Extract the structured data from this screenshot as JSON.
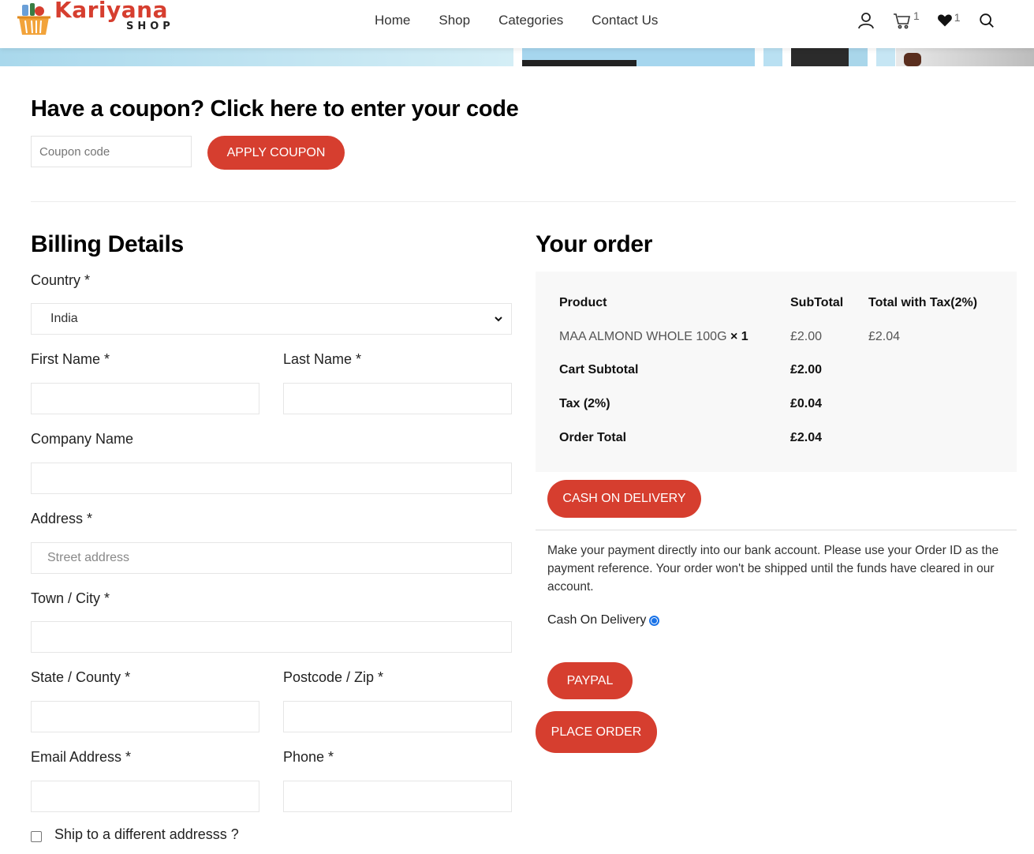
{
  "brand": {
    "name": "Kariyana",
    "sub": "SHOP"
  },
  "nav": [
    "Home",
    "Shop",
    "Categories",
    "Contact Us"
  ],
  "header_icons": {
    "cart_count": "1",
    "wishlist_count": "1"
  },
  "coupon": {
    "title": "Have a coupon? Click here to enter your code",
    "placeholder": "Coupon code",
    "button": "APPLY COUPON"
  },
  "billing": {
    "title": "Billing Details",
    "country_label": "Country *",
    "country_value": "India",
    "first_name_label": "First Name *",
    "last_name_label": "Last Name *",
    "company_label": "Company Name",
    "address_label": "Address *",
    "address_placeholder": "Street address",
    "town_label": "Town / City *",
    "state_label": "State / County *",
    "postcode_label": "Postcode / Zip *",
    "email_label": "Email Address *",
    "phone_label": "Phone *",
    "ship_label": "Ship to a different addresss ?"
  },
  "order": {
    "title": "Your order",
    "headers": {
      "product": "Product",
      "subtotal": "SubTotal",
      "total": "Total with Tax(2%)"
    },
    "item": {
      "name": "MAA ALMOND WHOLE 100G",
      "qty": "× 1",
      "subtotal": "£2.00",
      "total": "£2.04"
    },
    "cart_subtotal_label": "Cart Subtotal",
    "cart_subtotal": "£2.00",
    "tax_label": "Tax (2%)",
    "tax": "£0.04",
    "order_total_label": "Order Total",
    "order_total": "£2.04"
  },
  "payment": {
    "cod_button": "CASH ON DELIVERY",
    "description": "Make your payment directly into our bank account. Please use your Order ID as the payment reference. Your order won't be shipped until the funds have cleared in our account.",
    "cod_label": "Cash On Delivery",
    "paypal_button": "PAYPAL",
    "place_order_button": "PLACE ORDER"
  },
  "colors": {
    "accent": "#d63e2f",
    "radio": "#1a73e8"
  }
}
